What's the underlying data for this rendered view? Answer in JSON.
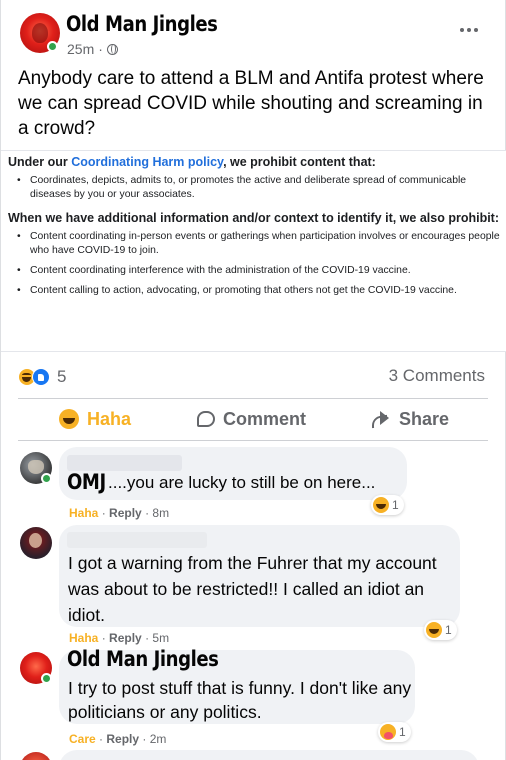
{
  "post": {
    "author": "Old Man Jingles",
    "time": "25m",
    "dot": "·",
    "text": "Anybody care to attend a BLM and Antifa protest where we can spread COVID while shouting and screaming in a crowd?",
    "more_icon": "more-horizontal-icon",
    "privacy_icon": "globe-icon"
  },
  "policy": {
    "heading_prefix": "Under our ",
    "heading_link": "Coordinating Harm policy",
    "heading_suffix": ", we prohibit content that:",
    "items1": [
      "Coordinates, depicts, admits to, or promotes the active and deliberate spread of communicable diseases by you or your associates."
    ],
    "heading2": "When we have additional information and/or context to identify it, we also prohibit:",
    "items2": [
      "Content coordinating in-person events or gatherings when participation involves or encourages people who have COVID-19 to join.",
      "Content coordinating interference with the administration of the COVID-19 vaccine.",
      "Content calling to action, advocating, or promoting that others not get the COVID-19 vaccine."
    ]
  },
  "stats": {
    "reactions_count": "5",
    "comments_count": "3 Comments",
    "reaction_icons": [
      "haha-icon",
      "like-icon"
    ]
  },
  "actions": {
    "haha": "Haha",
    "comment": "Comment",
    "share": "Share"
  },
  "comments": [
    {
      "name": "OMJ",
      "text": "....you are lucky to still be on here...",
      "reaction_label": "Haha",
      "reply": "Reply",
      "time": "8m",
      "react_count": "1",
      "sep": "·"
    },
    {
      "text": "I got a warning from the Fuhrer that my account was about to be restricted!! I called an idiot an idiot.",
      "reaction_label": "Haha",
      "reply": "Reply",
      "time": "5m",
      "react_count": "1",
      "sep": "·"
    },
    {
      "name": "Old Man Jingles",
      "text": "I try to post stuff that is funny. I don't like any politicians or any politics.",
      "reaction_label": "Care",
      "reply": "Reply",
      "time": "2m",
      "react_count": "1",
      "sep": "·"
    }
  ],
  "colors": {
    "haha": "#f7b125",
    "link": "#216fdb",
    "muted": "#65676b",
    "bubble": "#f0f2f5",
    "online": "#31a24c"
  }
}
